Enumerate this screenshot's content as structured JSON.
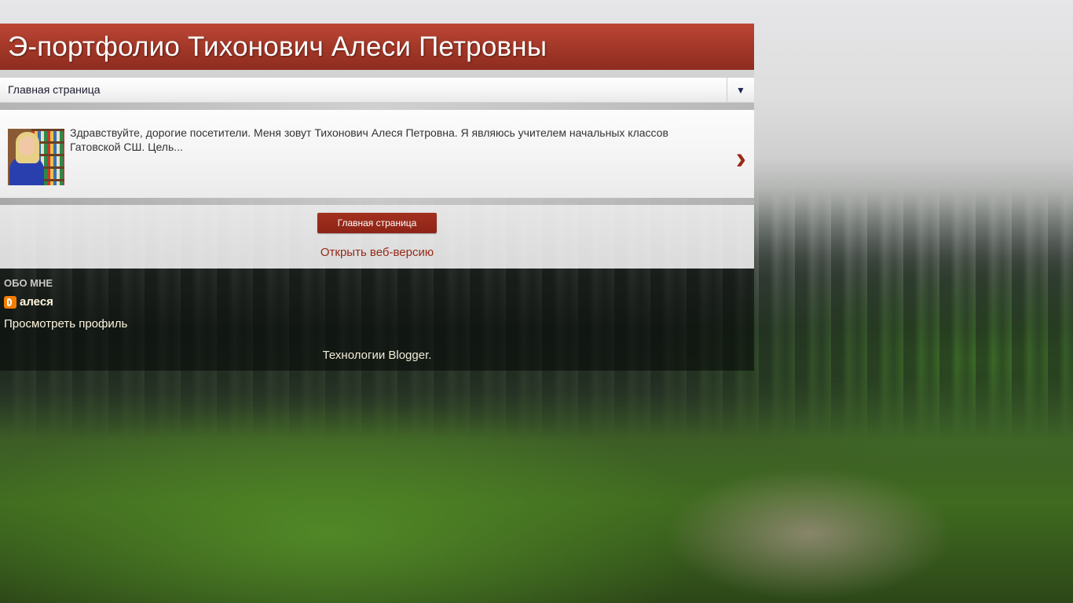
{
  "blog": {
    "title": "Э-портфолио Тихонович Алеси Петровны"
  },
  "nav": {
    "selected": "Главная страница",
    "arrow": "▼"
  },
  "post": {
    "snippet": "Здравствуйте, дорогие посетители.  Меня зовут Тихонович Алеся Петровна. Я являюсь учителем начальных классов Гатовской СШ. Цель...",
    "next_glyph": "›"
  },
  "footer": {
    "home_button": "Главная страница",
    "web_version_link": "Открыть веб-версию"
  },
  "about": {
    "heading": "ОБО МНЕ",
    "author": "алеся",
    "view_profile": "Просмотреть профиль",
    "powered_by_prefix": "Технологии ",
    "powered_by_link": "Blogger",
    "powered_by_suffix": "."
  },
  "colors": {
    "header_red": "#a13727",
    "button_red": "#962a18",
    "blogger_orange": "#f57d00"
  }
}
